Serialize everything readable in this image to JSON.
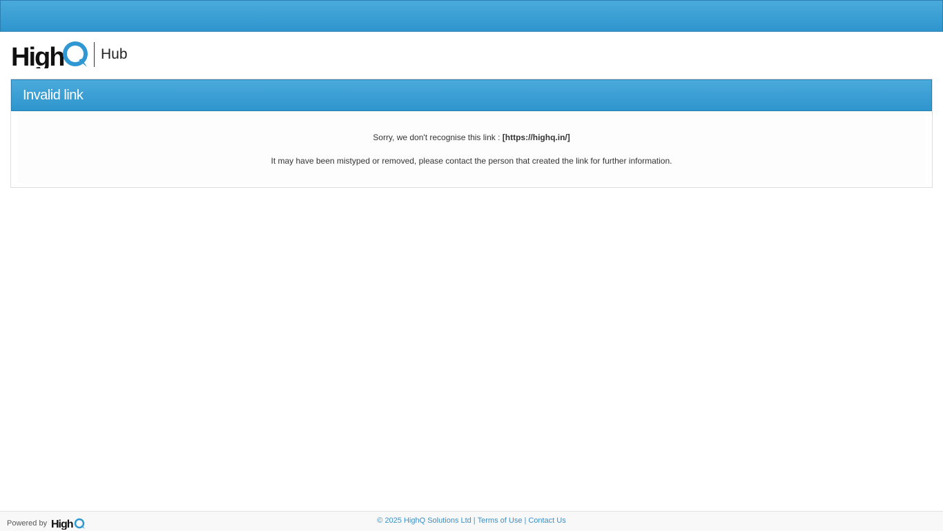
{
  "colors": {
    "accent": "#3399d0",
    "link": "#3a8fc6"
  },
  "brand": {
    "logo_text": "HighQ",
    "product": "Hub"
  },
  "panel": {
    "title": "Invalid link",
    "message_prefix": "Sorry, we don't recognise this link :",
    "link_value": "[https://highq.in/]",
    "message_detail": "It may have been mistyped or removed, please contact the person that created the link for further information."
  },
  "footer": {
    "powered_by": "Powered by",
    "powered_logo_text": "HighQ",
    "copyright": "© 2025 HighQ Solutions Ltd",
    "terms_label": "Terms of Use",
    "contact_label": "Contact Us"
  }
}
